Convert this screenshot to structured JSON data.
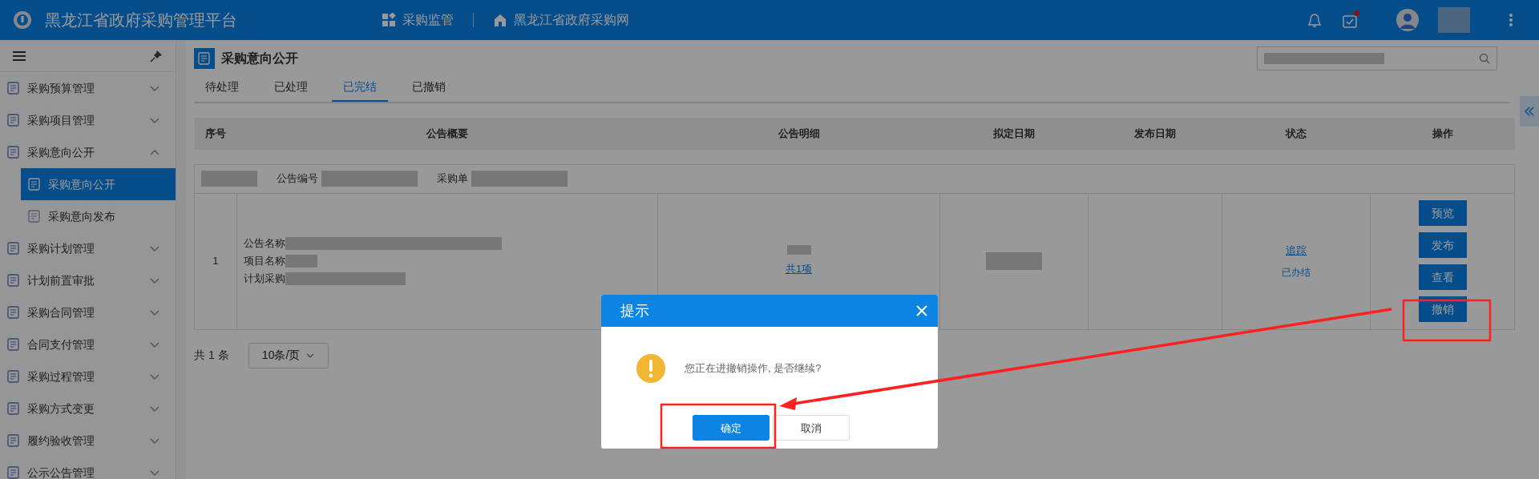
{
  "header": {
    "title": "黑龙江省政府采购管理平台",
    "nav": [
      {
        "label": "采购监管",
        "kind": "grid"
      },
      {
        "label": "黑龙江省政府采购网",
        "kind": "home"
      }
    ],
    "tasks_unread": true
  },
  "sidebar": {
    "items": [
      {
        "label": "采购预算管理",
        "expanded": false
      },
      {
        "label": "采购项目管理",
        "expanded": false
      },
      {
        "label": "采购意向公开",
        "expanded": true,
        "children": [
          {
            "label": "采购意向公开",
            "selected": true
          },
          {
            "label": "采购意向发布",
            "selected": false
          }
        ]
      },
      {
        "label": "采购计划管理",
        "expanded": false
      },
      {
        "label": "计划前置审批",
        "expanded": false
      },
      {
        "label": "采购合同管理",
        "expanded": false
      },
      {
        "label": "合同支付管理",
        "expanded": false
      },
      {
        "label": "采购过程管理",
        "expanded": false
      },
      {
        "label": "采购方式变更",
        "expanded": false
      },
      {
        "label": "履约验收管理",
        "expanded": false
      },
      {
        "label": "公示公告管理",
        "expanded": false
      }
    ]
  },
  "page": {
    "title": "采购意向公开",
    "tabs": [
      {
        "label": "待处理",
        "selected": false
      },
      {
        "label": "已处理",
        "selected": false
      },
      {
        "label": "已完结",
        "selected": true
      },
      {
        "label": "已撤销",
        "selected": false
      }
    ],
    "table": {
      "columns": [
        "序号",
        "公告概要",
        "公告明细",
        "拟定日期",
        "发布日期",
        "状态",
        "操作"
      ],
      "rows": [
        {
          "group_labels": [
            "公告编号",
            "采购单"
          ],
          "index": "1",
          "summary_labels": [
            "公告名称",
            "项目名称",
            "计划采购"
          ],
          "detail_link": "共1项",
          "status_link": "追踪",
          "status": "已办结",
          "actions": [
            "预览",
            "发布",
            "查看",
            "撤销"
          ]
        }
      ]
    },
    "pagination": {
      "total": "共 1 条",
      "page_size": "10条/页"
    }
  },
  "dialog": {
    "title": "提示",
    "message": "您正在进撤销操作, 是否继续?",
    "confirm": "确定",
    "cancel": "取消"
  }
}
